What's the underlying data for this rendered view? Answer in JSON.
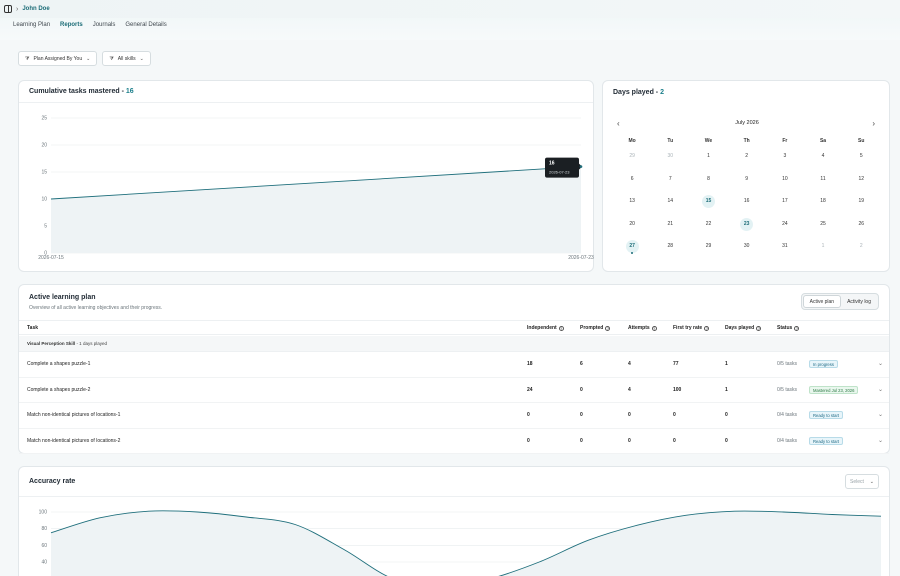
{
  "breadcrumb": {
    "name": "John Doe"
  },
  "tabs": [
    {
      "label": "Learning Plan"
    },
    {
      "label": "Reports"
    },
    {
      "label": "Journals"
    },
    {
      "label": "General Details"
    }
  ],
  "filters": {
    "plan": "Plan Assigned By You",
    "skills": "All skills"
  },
  "cumulative": {
    "title": "Cumulative tasks mastered - ",
    "count": "16",
    "tooltip": {
      "value": "16",
      "date": "2026-07-23"
    }
  },
  "days_played": {
    "title": "Days played - ",
    "count": "2",
    "month": "July 2026",
    "weekdays": [
      "Mo",
      "Tu",
      "We",
      "Th",
      "Fr",
      "Sa",
      "Su"
    ],
    "weeks": [
      [
        "29",
        "30",
        "1",
        "2",
        "3",
        "4",
        "5"
      ],
      [
        "6",
        "7",
        "8",
        "9",
        "10",
        "11",
        "12"
      ],
      [
        "13",
        "14",
        "15",
        "16",
        "17",
        "18",
        "19"
      ],
      [
        "20",
        "21",
        "22",
        "23",
        "24",
        "25",
        "26"
      ],
      [
        "27",
        "28",
        "29",
        "30",
        "31",
        "1",
        "2"
      ]
    ]
  },
  "active_plan": {
    "title": "Active learning plan",
    "subtitle": "Overview of all active learning objectives and their progress.",
    "toggle": {
      "active": "Active plan",
      "log": "Activity log"
    },
    "columns": {
      "task": "Task",
      "independent": "Independent",
      "prompted": "Prompted",
      "attempts": "Attempts",
      "first_try": "First try rate",
      "days": "Days played",
      "status": "Status"
    },
    "group": {
      "name": "Visual Perception Skill",
      "meta": " - 1 days played"
    },
    "rows": [
      {
        "task": "Complete a shapes puzzle-1",
        "independent": "18",
        "prompted": "6",
        "attempts": "4",
        "first_try": "77",
        "days": "1",
        "tasks": "0/5 tasks",
        "status": "In progress",
        "status_kind": "progress"
      },
      {
        "task": "Complete a shapes puzzle-2",
        "independent": "24",
        "prompted": "0",
        "attempts": "4",
        "first_try": "100",
        "days": "1",
        "tasks": "0/5 tasks",
        "status": "Mastered Jul 23, 2026",
        "status_kind": "mastered"
      },
      {
        "task": "Match non-identical pictures of locations-1",
        "independent": "0",
        "prompted": "0",
        "attempts": "0",
        "first_try": "0",
        "days": "0",
        "tasks": "0/4 tasks",
        "status": "Ready to start",
        "status_kind": "ready"
      },
      {
        "task": "Match non-identical pictures of locations-2",
        "independent": "0",
        "prompted": "0",
        "attempts": "0",
        "first_try": "0",
        "days": "0",
        "tasks": "0/4 tasks",
        "status": "Ready to start",
        "status_kind": "ready"
      }
    ]
  },
  "accuracy": {
    "title": "Accuracy rate",
    "select_placeholder": "Select"
  },
  "colors": {
    "accent": "#1b7f8b",
    "line": "#1f6f7c",
    "area": "#eef3f5"
  },
  "chart_data": [
    {
      "type": "area",
      "title": "Cumulative tasks mastered - 16",
      "x": [
        "2026-07-15",
        "2026-07-23"
      ],
      "series": [
        {
          "values": [
            10,
            16
          ]
        }
      ],
      "yticks": [
        0,
        5,
        10,
        15,
        20,
        25
      ],
      "xticks": [
        "2026-07-15",
        "2026-07-23"
      ],
      "ylim": [
        0,
        25
      ],
      "grid": true
    },
    {
      "type": "area",
      "title": "Accuracy rate",
      "series": [
        {
          "values": [
            75,
            93,
            101,
            100,
            94,
            85,
            55,
            20,
            10,
            20,
            40,
            66,
            84,
            96,
            101,
            100,
            97,
            95
          ]
        }
      ],
      "yticks": [
        40,
        60,
        80,
        100
      ],
      "ylim": [
        40,
        110
      ],
      "grid": true
    }
  ]
}
